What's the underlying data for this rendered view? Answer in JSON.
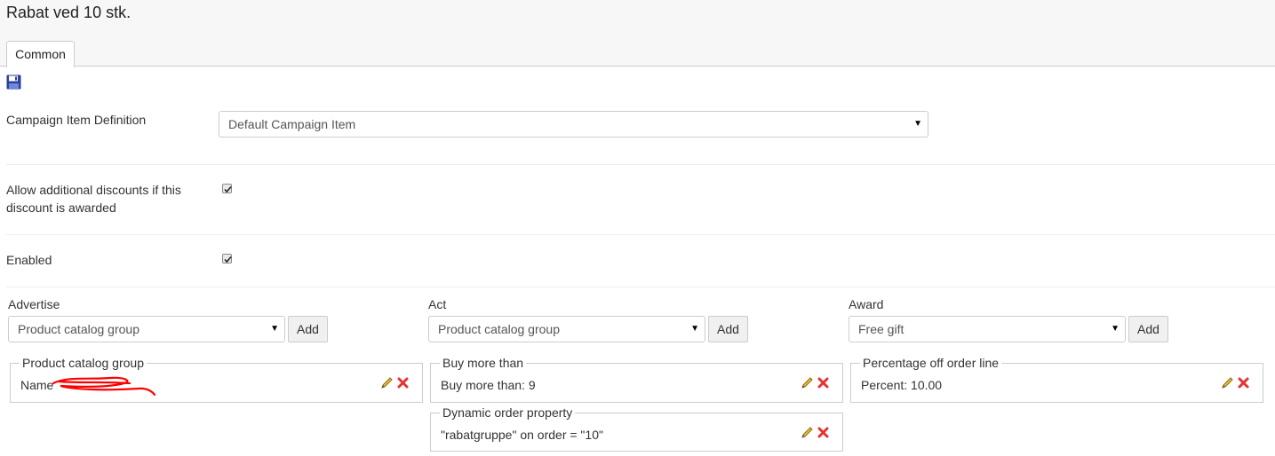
{
  "page": {
    "title": "Rabat ved 10 stk."
  },
  "tabs": [
    {
      "label": "Common"
    }
  ],
  "form": {
    "campaign_item_definition": {
      "label": "Campaign Item Definition",
      "value": "Default Campaign Item"
    },
    "allow_additional_discounts": {
      "label_line1": "Allow additional discounts if this",
      "label_line2": "discount is awarded",
      "checked": true
    },
    "enabled": {
      "label": "Enabled",
      "checked": true
    }
  },
  "columns": {
    "advertise": {
      "label": "Advertise",
      "select_value": "Product catalog group",
      "add_label": "Add"
    },
    "act": {
      "label": "Act",
      "select_value": "Product catalog group",
      "add_label": "Add"
    },
    "award": {
      "label": "Award",
      "select_value": "Free gift",
      "add_label": "Add"
    }
  },
  "rules": {
    "advertise": [
      {
        "title": "Product catalog group",
        "text": "Name"
      }
    ],
    "act": [
      {
        "title": "Buy more than",
        "text": "Buy more than: 9"
      },
      {
        "title": "Dynamic order property",
        "text": "\"rabatgruppe\" on order = \"10\""
      }
    ],
    "award": [
      {
        "title": "Percentage off order line",
        "text": "Percent: 10.00"
      }
    ]
  },
  "icons": {
    "save": "save-icon",
    "edit": "pencil-icon",
    "delete": "delete-icon",
    "caret": "caret-down-icon"
  },
  "colors": {
    "delete": "#e53333",
    "pencil": "#e0b020",
    "save": "#2a3f9f",
    "redaction": "#ff0000"
  }
}
